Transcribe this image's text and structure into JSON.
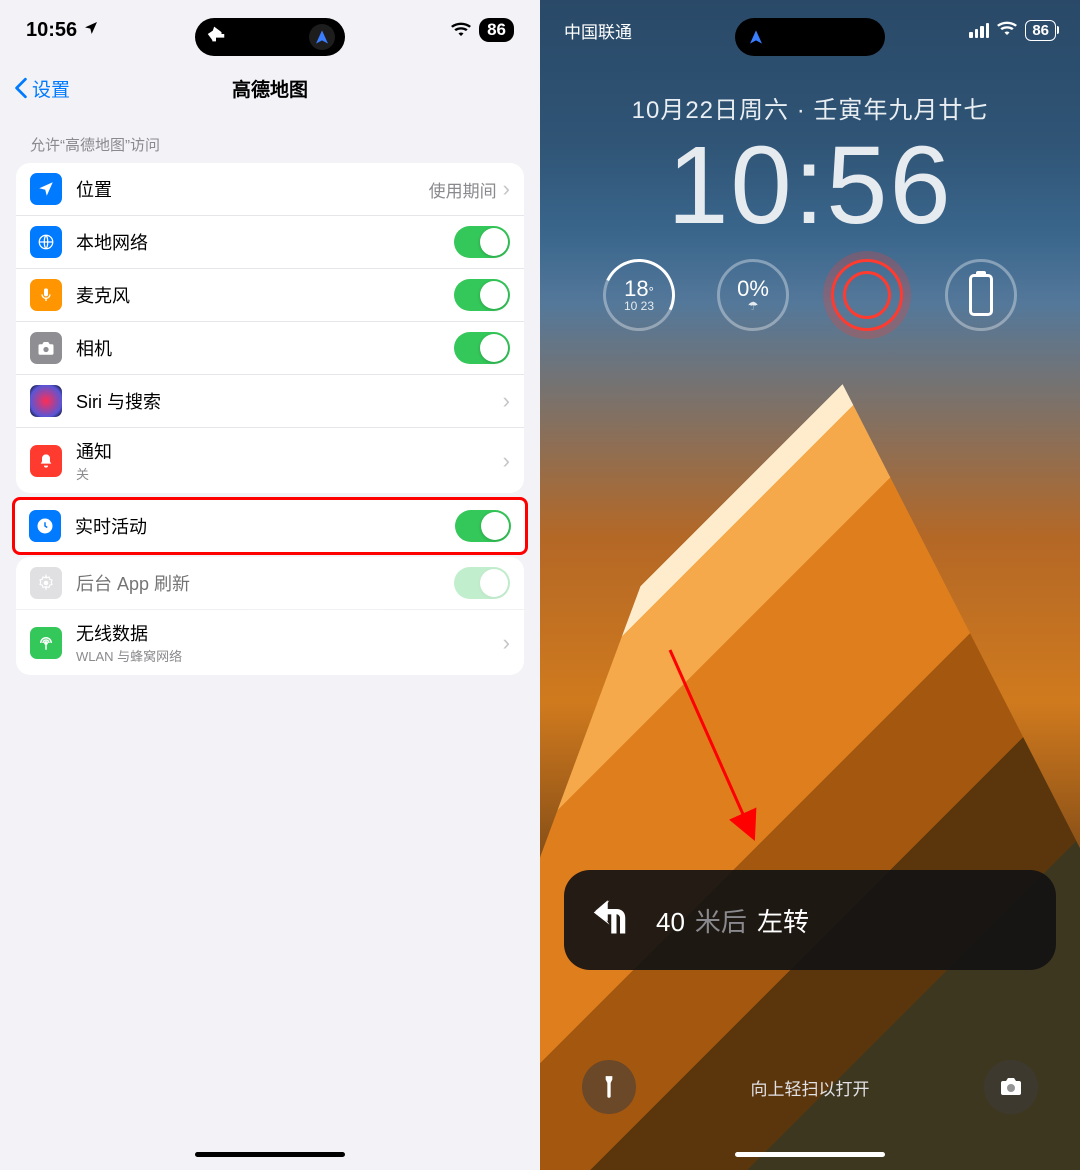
{
  "left": {
    "status": {
      "time": "10:56",
      "battery": "86"
    },
    "nav": {
      "back": "设置",
      "title": "高德地图"
    },
    "section_header": "允许“高德地图”访问",
    "items": {
      "location": {
        "label": "位置",
        "value": "使用期间"
      },
      "localnet": {
        "label": "本地网络"
      },
      "mic": {
        "label": "麦克风"
      },
      "camera": {
        "label": "相机"
      },
      "siri": {
        "label": "Siri 与搜索"
      },
      "notif": {
        "label": "通知",
        "sub": "关"
      },
      "live": {
        "label": "实时活动"
      },
      "bgrefresh": {
        "label": "后台 App 刷新"
      },
      "wireless": {
        "label": "无线数据",
        "sub": "WLAN 与蜂窝网络"
      }
    }
  },
  "right": {
    "status": {
      "carrier": "中国联通",
      "battery": "86"
    },
    "date": "10月22日周六 · 壬寅年九月廿七",
    "time": "10:56",
    "widgets": {
      "weather": {
        "temp": "18",
        "lowhigh": "10  23"
      },
      "rain": {
        "pct": "0%"
      }
    },
    "live_activity": {
      "distance": "40",
      "unit": "米后",
      "action": "左转"
    },
    "swipe_hint": "向上轻扫以打开"
  }
}
